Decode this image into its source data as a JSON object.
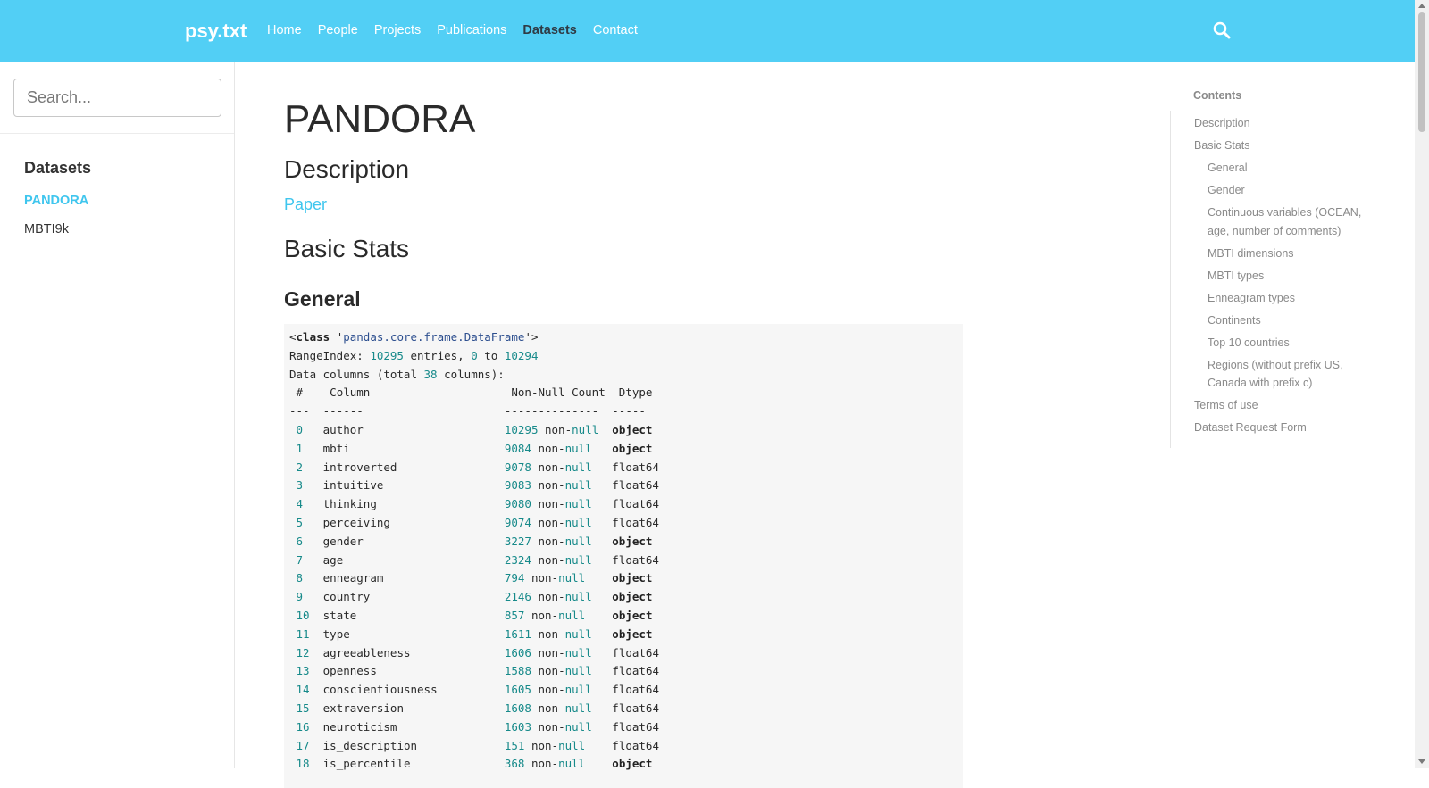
{
  "navbar": {
    "brand": "psy.txt",
    "links": [
      "Home",
      "People",
      "Projects",
      "Publications",
      "Datasets",
      "Contact"
    ],
    "active_link": "Datasets",
    "search_icon": "search-icon"
  },
  "sidebar": {
    "search_placeholder": "Search...",
    "heading": "Datasets",
    "items": [
      {
        "label": "PANDORA",
        "active": true
      },
      {
        "label": "MBTI9k",
        "active": false
      }
    ]
  },
  "main": {
    "title": "PANDORA",
    "description_heading": "Description",
    "paper_link": "Paper",
    "basic_stats_heading": "Basic Stats",
    "general_heading": "General",
    "info": {
      "class_kw": "class",
      "class_name": "pandas.core.frame.DataFrame",
      "range_entries": "10295",
      "range_start": "0",
      "range_end": "10294",
      "total_columns": "38",
      "header": {
        "idx": "#",
        "column": "Column",
        "count": "Non-Null Count",
        "dtype": "Dtype"
      },
      "sep": {
        "idx": "---",
        "column": "------",
        "count": "--------------",
        "dtype": "-----"
      },
      "columns": [
        {
          "idx": "0",
          "name": "author",
          "count": "10295",
          "dtype": "object"
        },
        {
          "idx": "1",
          "name": "mbti",
          "count": "9084",
          "dtype": "object"
        },
        {
          "idx": "2",
          "name": "introverted",
          "count": "9078",
          "dtype": "float64"
        },
        {
          "idx": "3",
          "name": "intuitive",
          "count": "9083",
          "dtype": "float64"
        },
        {
          "idx": "4",
          "name": "thinking",
          "count": "9080",
          "dtype": "float64"
        },
        {
          "idx": "5",
          "name": "perceiving",
          "count": "9074",
          "dtype": "float64"
        },
        {
          "idx": "6",
          "name": "gender",
          "count": "3227",
          "dtype": "object"
        },
        {
          "idx": "7",
          "name": "age",
          "count": "2324",
          "dtype": "float64"
        },
        {
          "idx": "8",
          "name": "enneagram",
          "count": "794",
          "dtype": "object"
        },
        {
          "idx": "9",
          "name": "country",
          "count": "2146",
          "dtype": "object"
        },
        {
          "idx": "10",
          "name": "state",
          "count": "857",
          "dtype": "object"
        },
        {
          "idx": "11",
          "name": "type",
          "count": "1611",
          "dtype": "object"
        },
        {
          "idx": "12",
          "name": "agreeableness",
          "count": "1606",
          "dtype": "float64"
        },
        {
          "idx": "13",
          "name": "openness",
          "count": "1588",
          "dtype": "float64"
        },
        {
          "idx": "14",
          "name": "conscientiousness",
          "count": "1605",
          "dtype": "float64"
        },
        {
          "idx": "15",
          "name": "extraversion",
          "count": "1608",
          "dtype": "float64"
        },
        {
          "idx": "16",
          "name": "neuroticism",
          "count": "1603",
          "dtype": "float64"
        },
        {
          "idx": "17",
          "name": "is_description",
          "count": "151",
          "dtype": "float64"
        },
        {
          "idx": "18",
          "name": "is_percentile",
          "count": "368",
          "dtype": "object"
        }
      ]
    }
  },
  "toc": {
    "title": "Contents",
    "items": [
      {
        "label": "Description",
        "sub": false
      },
      {
        "label": "Basic Stats",
        "sub": false
      },
      {
        "label": "General",
        "sub": true
      },
      {
        "label": "Gender",
        "sub": true
      },
      {
        "label": "Continuous variables (OCEAN, age, number of comments)",
        "sub": true
      },
      {
        "label": "MBTI dimensions",
        "sub": true
      },
      {
        "label": "MBTI types",
        "sub": true
      },
      {
        "label": "Enneagram types",
        "sub": true
      },
      {
        "label": "Continents",
        "sub": true
      },
      {
        "label": "Top 10 countries",
        "sub": true
      },
      {
        "label": "Regions (without prefix US, Canada with prefix c)",
        "sub": true
      },
      {
        "label": "Terms of use",
        "sub": false
      },
      {
        "label": "Dataset Request Form",
        "sub": false
      }
    ]
  }
}
